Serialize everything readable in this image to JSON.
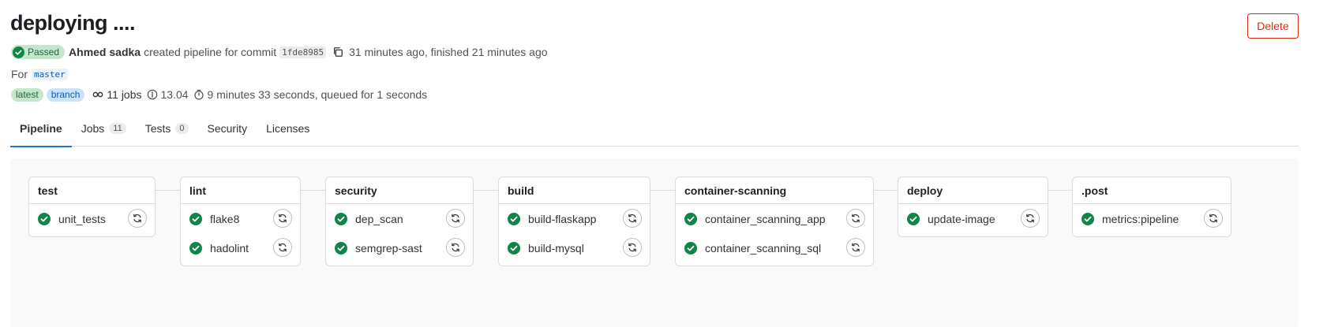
{
  "header": {
    "title": "deploying ....",
    "delete_label": "Delete"
  },
  "meta": {
    "status": "Passed",
    "author": "Ahmed sadka",
    "action_text": "created pipeline for commit",
    "commit_sha": "1fde8985",
    "timing": "31 minutes ago, finished 21 minutes ago",
    "for_label": "For",
    "branch": "master",
    "badges": [
      "latest",
      "branch"
    ],
    "jobs_count": "11 jobs",
    "version": "13.04",
    "duration": "9 minutes 33 seconds, queued for 1 seconds"
  },
  "tabs": [
    {
      "label": "Pipeline",
      "count": null
    },
    {
      "label": "Jobs",
      "count": "11"
    },
    {
      "label": "Tests",
      "count": "0"
    },
    {
      "label": "Security",
      "count": null
    },
    {
      "label": "Licenses",
      "count": null
    }
  ],
  "stages": [
    {
      "name": "test",
      "jobs": [
        "unit_tests"
      ]
    },
    {
      "name": "lint",
      "jobs": [
        "flake8",
        "hadolint"
      ]
    },
    {
      "name": "security",
      "jobs": [
        "dep_scan",
        "semgrep-sast"
      ]
    },
    {
      "name": "build",
      "jobs": [
        "build-flaskapp",
        "build-mysql"
      ]
    },
    {
      "name": "container-scanning",
      "jobs": [
        "container_scanning_app",
        "container_scanning_sql"
      ]
    },
    {
      "name": "deploy",
      "jobs": [
        "update-image"
      ]
    },
    {
      "name": ".post",
      "jobs": [
        "metrics:pipeline"
      ]
    }
  ],
  "colors": {
    "success": "#108548",
    "danger": "#dd2b0e",
    "accent": "#1f75cb"
  }
}
